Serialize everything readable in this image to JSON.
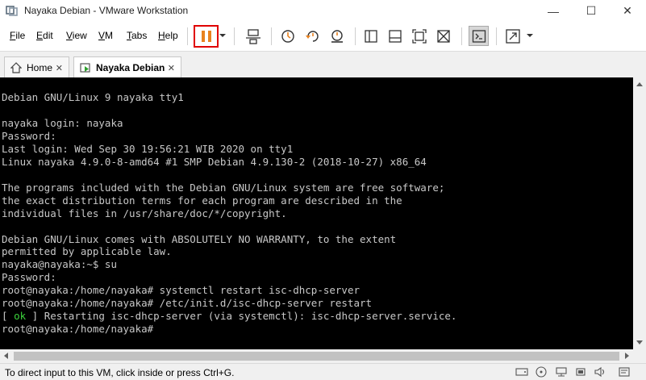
{
  "window": {
    "title": "Nayaka Debian - VMware Workstation",
    "minimize": "—",
    "maximize": "☐",
    "close": "✕"
  },
  "menu": {
    "items": [
      {
        "label": "File",
        "mnemonic": "F",
        "rest": "ile"
      },
      {
        "label": "Edit",
        "mnemonic": "E",
        "rest": "dit"
      },
      {
        "label": "View",
        "mnemonic": "V",
        "rest": "iew"
      },
      {
        "label": "VM",
        "mnemonic": "V",
        "rest": "M"
      },
      {
        "label": "Tabs",
        "mnemonic": "T",
        "rest": "abs"
      },
      {
        "label": "Help",
        "mnemonic": "H",
        "rest": "elp"
      }
    ]
  },
  "tabs": [
    {
      "label": "Home",
      "icon": "home-icon",
      "active": false
    },
    {
      "label": "Nayaka Debian",
      "icon": "vm-running-icon",
      "active": true
    }
  ],
  "console": {
    "lines": [
      "Debian GNU/Linux 9 nayaka tty1",
      "",
      "nayaka login: nayaka",
      "Password:",
      "Last login: Wed Sep 30 19:56:21 WIB 2020 on tty1",
      "Linux nayaka 4.9.0-8-amd64 #1 SMP Debian 4.9.130-2 (2018-10-27) x86_64",
      "",
      "The programs included with the Debian GNU/Linux system are free software;",
      "the exact distribution terms for each program are described in the",
      "individual files in /usr/share/doc/*/copyright.",
      "",
      "Debian GNU/Linux comes with ABSOLUTELY NO WARRANTY, to the extent",
      "permitted by applicable law.",
      "nayaka@nayaka:~$ su",
      "Password:",
      "root@nayaka:/home/nayaka# systemctl restart isc-dhcp-server",
      "root@nayaka:/home/nayaka# /etc/init.d/isc-dhcp-server restart"
    ],
    "ok_line": {
      "open": "[ ",
      "ok": "ok",
      "rest": " ] Restarting isc-dhcp-server (via systemctl): isc-dhcp-server.service."
    },
    "prompt": "root@nayaka:/home/nayaka#",
    "colors": {
      "background": "#000000",
      "text": "#c8c8c8",
      "ok": "#3cd23c"
    }
  },
  "status": {
    "text": "To direct input to this VM, click inside or press Ctrl+G."
  },
  "colors": {
    "pause_highlight": "#e00000",
    "pause_icon": "#e8821f",
    "accent_icon": "#e8821f"
  }
}
